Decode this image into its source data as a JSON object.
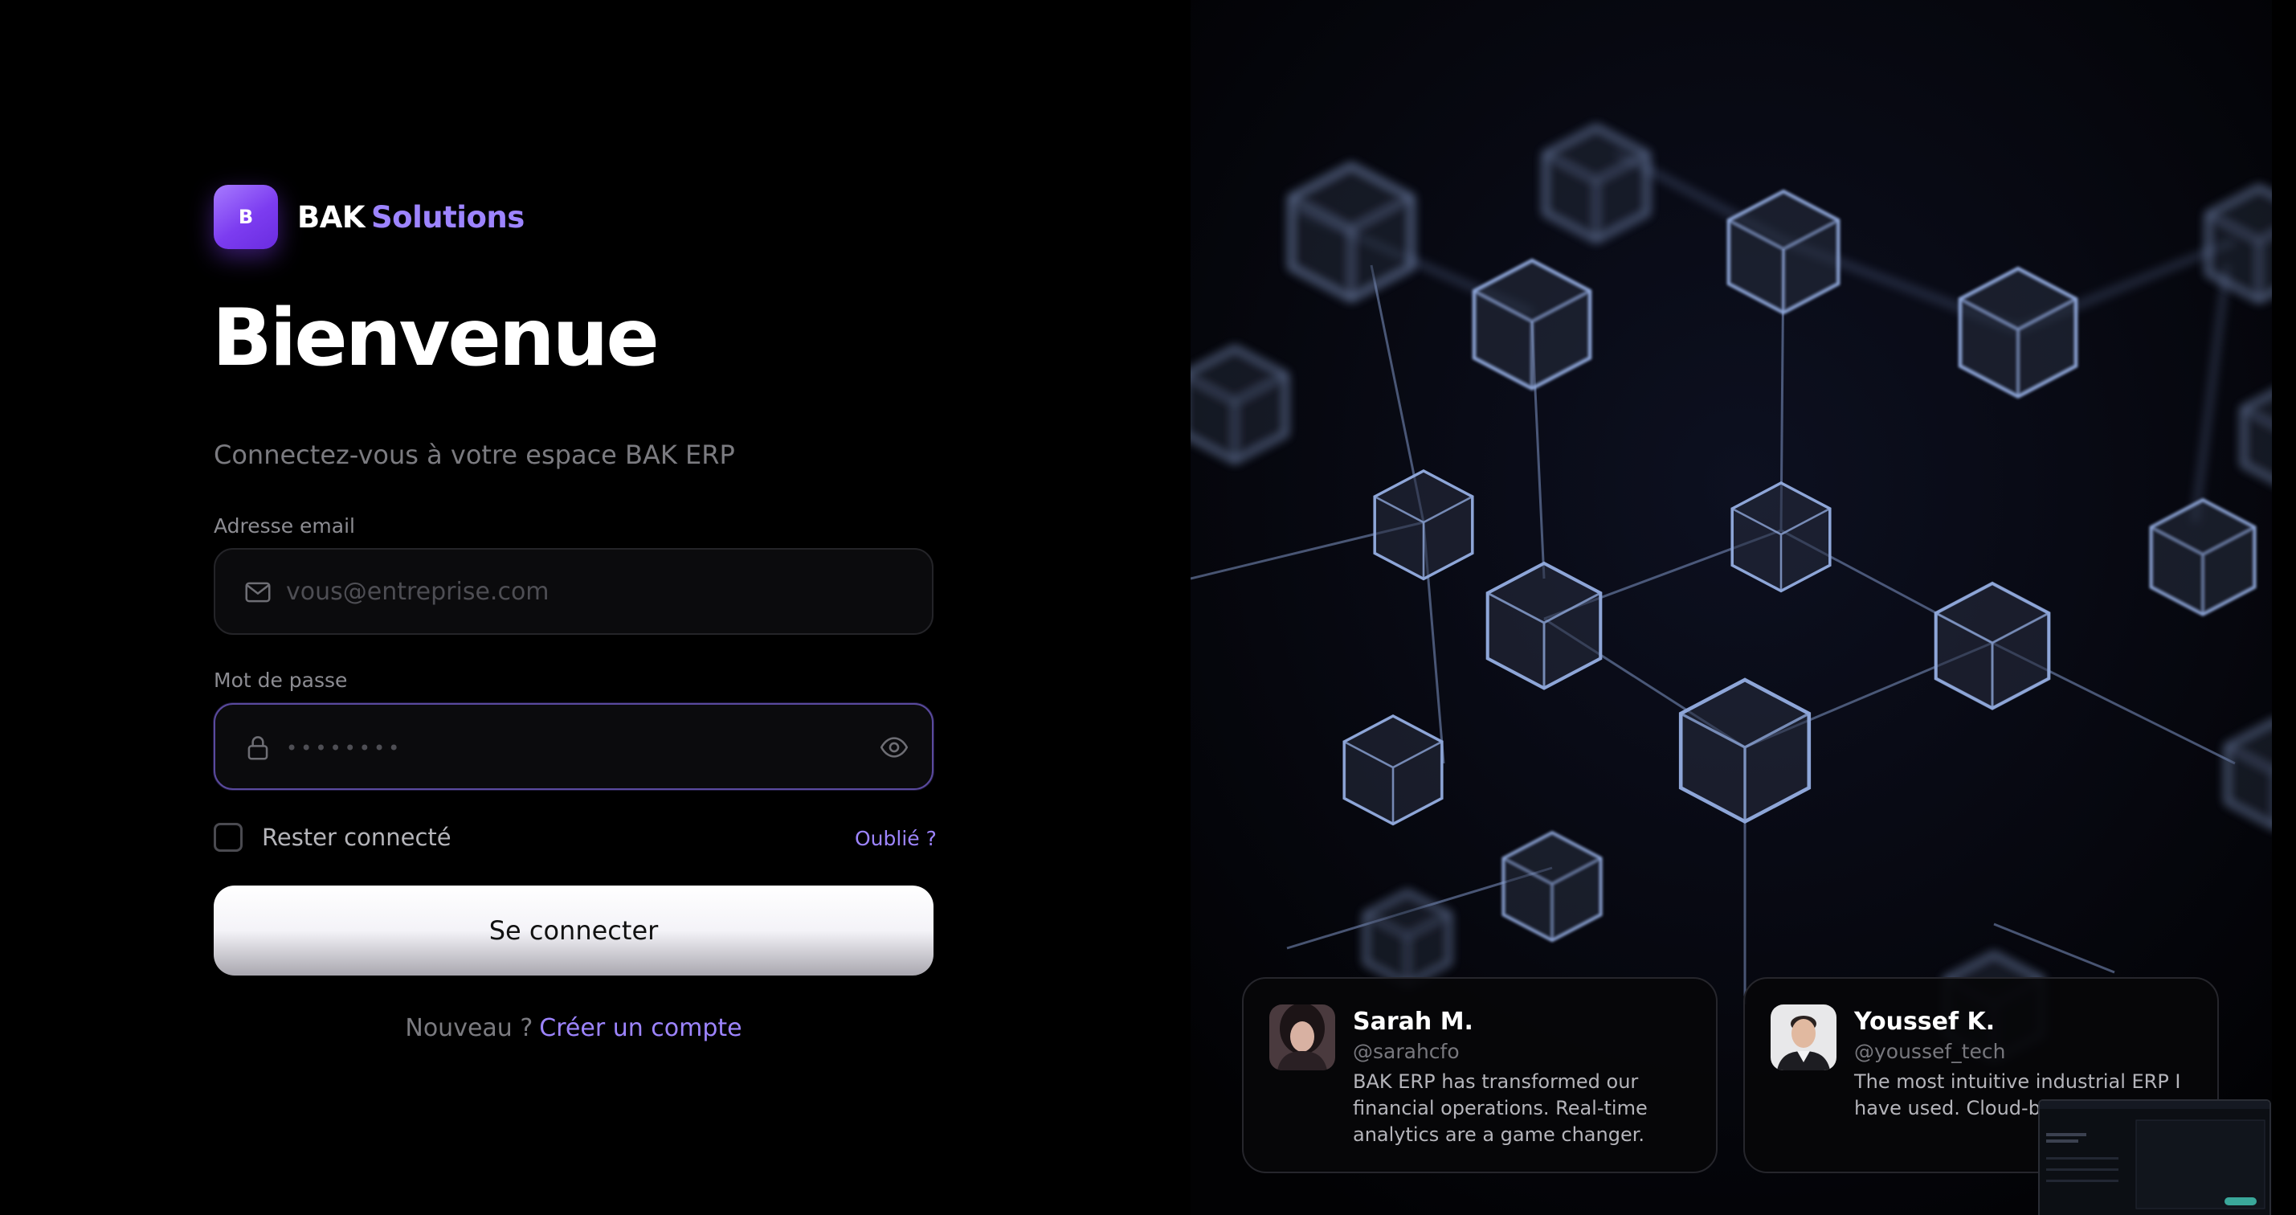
{
  "brand": {
    "logo_letter": "B",
    "name_part1": "BAK",
    "name_part2": "Solutions",
    "accent_color": "#9d84ff"
  },
  "login": {
    "title": "Bienvenue",
    "subtitle": "Connectez-vous à votre espace BAK ERP",
    "email_label": "Adresse email",
    "email_placeholder": "vous@entreprise.com",
    "email_icon": "mail-icon",
    "password_label": "Mot de passe",
    "password_placeholder": "••••••••",
    "password_icon": "lock-icon",
    "show_password_icon": "eye-icon",
    "remember_label": "Rester connecté",
    "forgot_label": "Oublié ?",
    "submit_label": "Se connecter",
    "signup_prompt": "Nouveau ?",
    "signup_link": "Créer un compte"
  },
  "testimonials": [
    {
      "name": "Sarah M.",
      "handle": "@sarahcfo",
      "text": "BAK ERP has transformed our financial operations. Real-time analytics are a game changer."
    },
    {
      "name": "Youssef K.",
      "handle": "@youssef_tech",
      "text": "The most intuitive industrial ERP I have used. Cloud-blazing fast."
    }
  ]
}
